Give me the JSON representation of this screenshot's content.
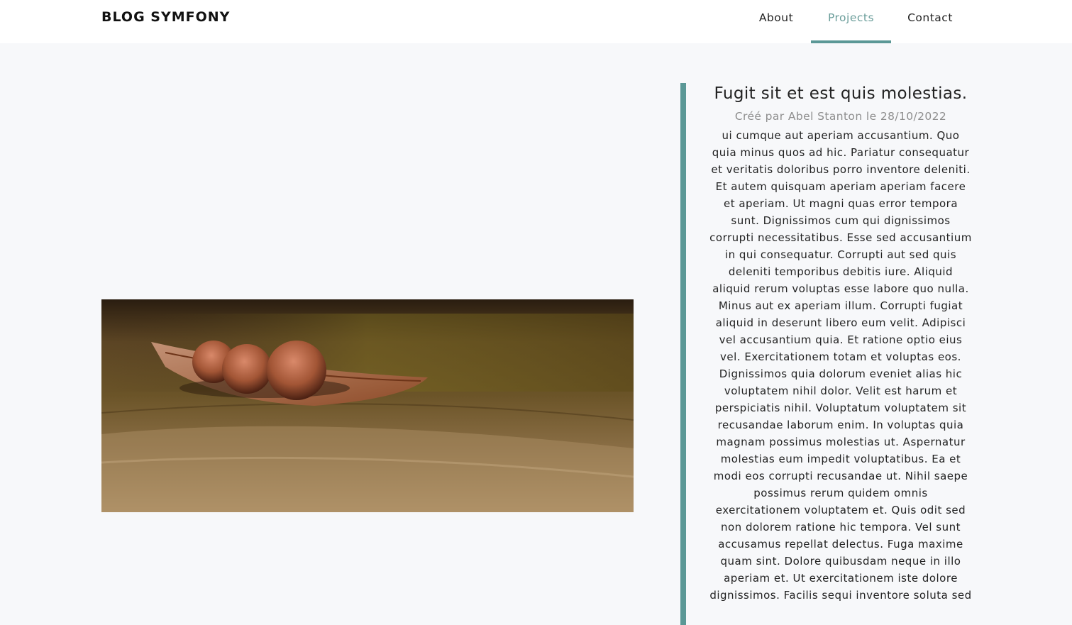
{
  "navbar": {
    "brand": "BLOG SYMFONY",
    "links": [
      {
        "label": "About",
        "active": false
      },
      {
        "label": "Projects",
        "active": true
      },
      {
        "label": "Contact",
        "active": false
      }
    ]
  },
  "colors": {
    "accent": "#5b9896",
    "active_link": "#6a9d9a",
    "background": "#f7f8fa",
    "meta_text": "#8e8e8e"
  },
  "article": {
    "title": "Fugit sit et est quis molestias.",
    "meta": "Créé par Abel Stanton le 28/10/2022",
    "body": "ui cumque aut aperiam accusantium. Quo quia minus quos ad hic. Pariatur consequatur et veritatis doloribus porro inventore deleniti. Et autem quisquam aperiam aperiam facere et aperiam. Ut magni quas error tempora sunt. Dignissimos cum qui dignissimos corrupti necessitatibus. Esse sed accusantium in qui consequatur. Corrupti aut sed quis deleniti temporibus debitis iure. Aliquid aliquid rerum voluptas esse labore quo nulla. Minus aut ex aperiam illum. Corrupti fugiat aliquid in deserunt libero eum velit. Adipisci vel accusantium quia. Et ratione optio eius vel. Exercitationem totam et voluptas eos. Dignissimos quia dolorum eveniet alias hic voluptatem nihil dolor. Velit est harum et perspiciatis nihil. Voluptatum voluptatem sit recusandae laborum enim. In voluptas quia magnam possimus molestias ut. Aspernatur molestias eum impedit voluptatibus. Ea et modi eos corrupti recusandae ut. Nihil saepe possimus rerum quidem omnis exercitationem voluptatem et. Quis odit sed non dolorem ratione hic tempora. Vel sunt accusamus repellat delectus. Fuga maxime quam sint. Dolore quibusdam neque in illo aperiam et. Ut exercitationem iste dolore dignissimos. Facilis sequi inventore soluta sed"
  }
}
